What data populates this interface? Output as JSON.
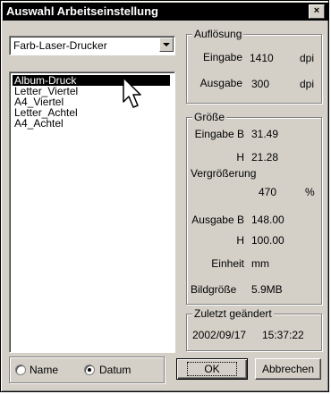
{
  "window": {
    "title": "Auswahl Arbeitseinstellung"
  },
  "device_combo": {
    "value": "Farb-Laser-Drucker"
  },
  "settings_list": {
    "items": [
      "Album-Druck",
      "Letter_Viertel",
      "A4_Viertel",
      "Letter_Achtel",
      "A4_Achtel"
    ],
    "selected": "Album-Druck"
  },
  "aufloesung": {
    "legend": "Auflösung",
    "eingabe_label": "Eingabe",
    "eingabe_value": "1410",
    "eingabe_unit": "dpi",
    "ausgabe_label": "Ausgabe",
    "ausgabe_value": "300",
    "ausgabe_unit": "dpi"
  },
  "groesse": {
    "legend": "Größe",
    "eingabe_b_label": "Eingabe B",
    "eingabe_b_value": "31.49",
    "eingabe_h_label": "H",
    "eingabe_h_value": "21.28",
    "vergroesserung_label": "Vergrößerung",
    "vergroesserung_value": "470",
    "vergroesserung_unit": "%",
    "ausgabe_b_label": "Ausgabe B",
    "ausgabe_b_value": "148.00",
    "ausgabe_h_label": "H",
    "ausgabe_h_value": "100.00",
    "einheit_label": "Einheit",
    "einheit_value": "mm",
    "bildgroesse_label": "Bildgröße",
    "bildgroesse_value": "5.9MB"
  },
  "zuletzt": {
    "legend": "Zuletzt geändert",
    "date": "2002/09/17",
    "time": "15:37:22"
  },
  "sort": {
    "name_label": "Name",
    "datum_label": "Datum",
    "selected": "Datum"
  },
  "buttons": {
    "ok": "OK",
    "cancel": "Abbrechen",
    "close": "×"
  }
}
